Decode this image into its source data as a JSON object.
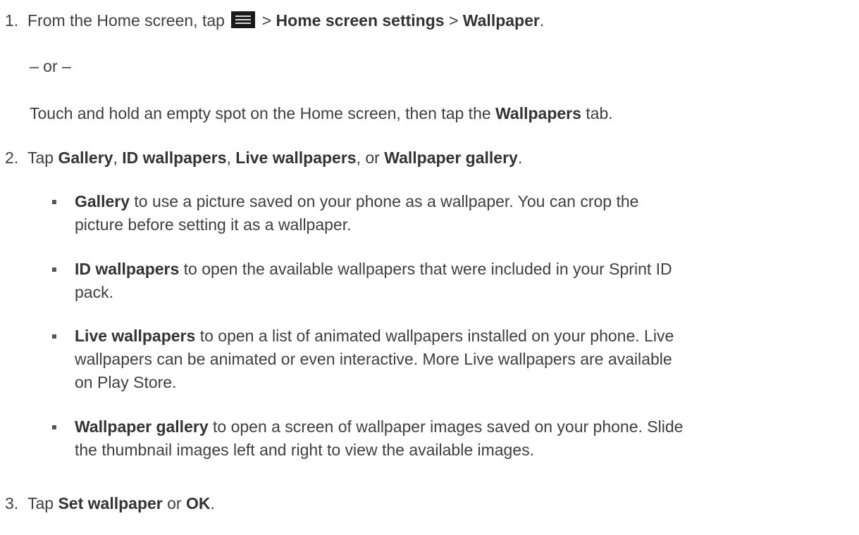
{
  "steps": [
    {
      "number": "1.",
      "prefix": "From the Home screen, tap",
      "icon": "menu-icon",
      "sep1": " > ",
      "bold1": "Home screen settings",
      "sep2": " > ",
      "bold2": "Wallpaper",
      "end": ".",
      "or_text": "– or –",
      "alt_prefix": "Touch and hold an empty spot on the Home screen, then tap the ",
      "alt_bold": "Wallpapers",
      "alt_suffix": " tab."
    },
    {
      "number": "2.",
      "t0": "Tap ",
      "b1": "Gallery",
      "t1": ", ",
      "b2": "ID wallpapers",
      "t2": ", ",
      "b3": "Live wallpapers",
      "t3": ", or ",
      "b4": "Wallpaper gallery",
      "t4": ".",
      "bullets": [
        {
          "bold": "Gallery",
          "lines": [
            " to use a picture saved on your phone as a wallpaper. You can crop the",
            "picture before setting it as a wallpaper."
          ]
        },
        {
          "bold": "ID wallpapers",
          "lines": [
            " to open the available wallpapers that were included in your Sprint ID",
            "pack."
          ]
        },
        {
          "bold": "Live wallpapers",
          "lines": [
            " to open a list of animated wallpapers installed on your phone. Live",
            "wallpapers can be animated or even interactive. More Live wallpapers are available",
            "on Play Store."
          ]
        },
        {
          "bold": "Wallpaper gallery",
          "lines": [
            " to open a screen of wallpaper images saved on your phone. Slide",
            "the thumbnail images left and right to view the available images."
          ]
        }
      ]
    },
    {
      "number": "3.",
      "t0": "Tap ",
      "b1": "Set wallpaper",
      "t1": " or ",
      "b2": "OK",
      "t2": "."
    }
  ]
}
